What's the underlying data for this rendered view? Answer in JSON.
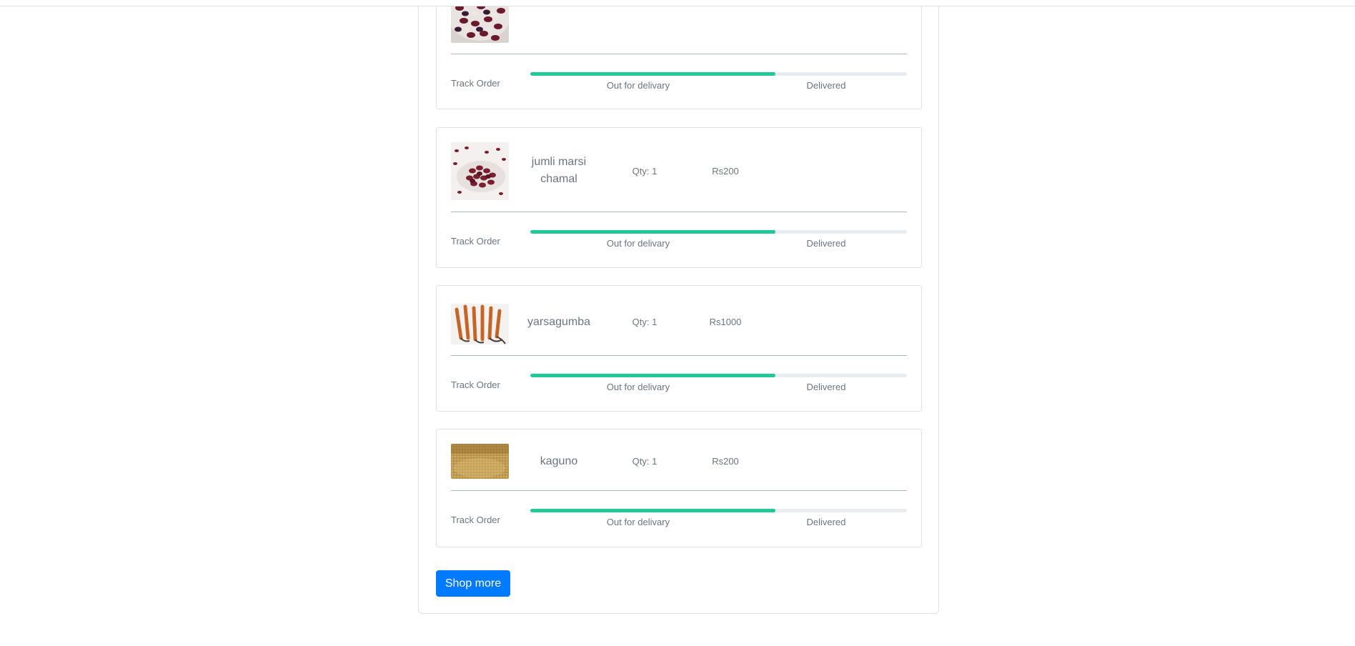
{
  "orders": [
    {
      "name": "",
      "qty": "",
      "price": "",
      "image_icon": "red-beans-image",
      "track_label": "Track Order",
      "progress": 0.65,
      "step_out": "Out for delivary",
      "step_delivered": "Delivered"
    },
    {
      "name": "jumli marsi chamal",
      "qty": "Qty: 1",
      "price": "Rs200",
      "image_icon": "red-beans-image",
      "track_label": "Track Order",
      "progress": 0.65,
      "step_out": "Out for delivary",
      "step_delivered": "Delivered"
    },
    {
      "name": "yarsagumba",
      "qty": "Qty: 1",
      "price": "Rs1000",
      "image_icon": "yarsagumba-image",
      "track_label": "Track Order",
      "progress": 0.65,
      "step_out": "Out for delivary",
      "step_delivered": "Delivered"
    },
    {
      "name": "kaguno",
      "qty": "Qty: 1",
      "price": "Rs200",
      "image_icon": "millet-grain-image",
      "track_label": "Track Order",
      "progress": 0.65,
      "step_out": "Out for delivary",
      "step_delivered": "Delivered"
    }
  ],
  "shop_more_label": "Shop more",
  "colors": {
    "progress_fill": "#20c997",
    "progress_track": "#e9ecef",
    "button": "#007bff"
  }
}
